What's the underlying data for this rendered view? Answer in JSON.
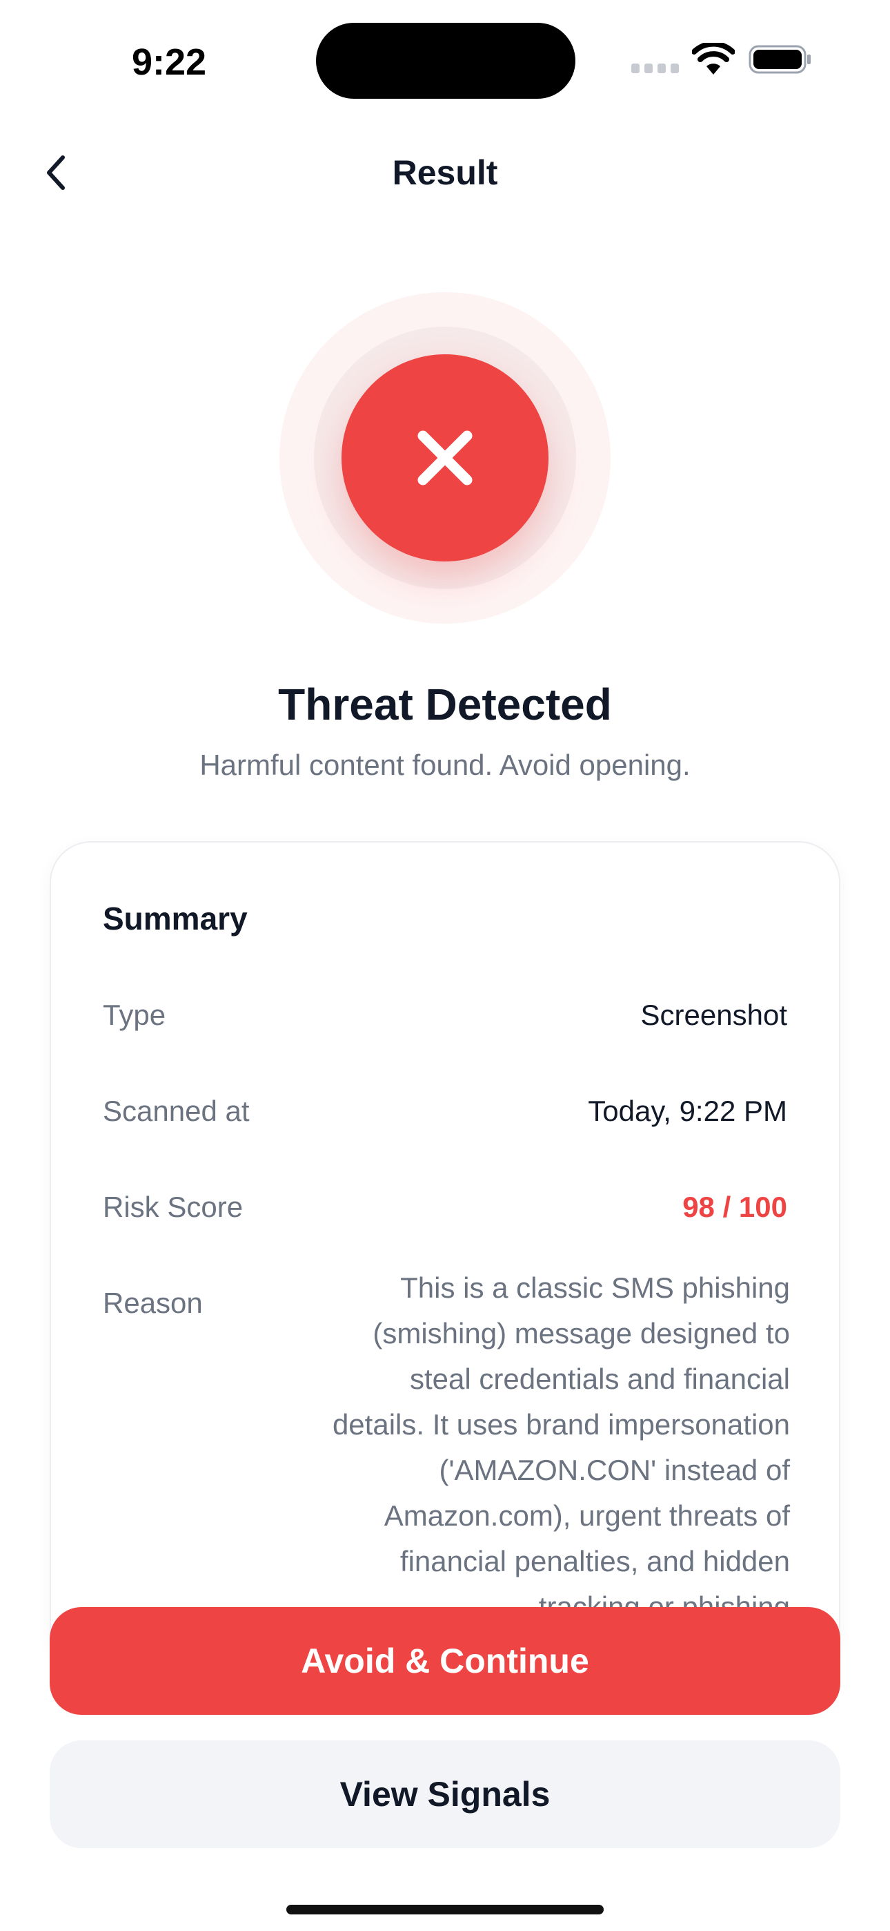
{
  "status_bar": {
    "time": "9:22",
    "icons": [
      "cellular-signal-icon",
      "wifi-icon",
      "battery-icon"
    ]
  },
  "nav": {
    "title": "Result",
    "back_icon": "chevron-left-icon"
  },
  "result": {
    "icon": "x-mark-icon",
    "headline": "Threat Detected",
    "subhead": "Harmful content found. Avoid opening."
  },
  "summary": {
    "title": "Summary",
    "rows": [
      {
        "label": "Type",
        "value": "Screenshot"
      },
      {
        "label": "Scanned at",
        "value": "Today, 9:22 PM"
      },
      {
        "label": "Risk Score",
        "value": "98 / 100"
      },
      {
        "label": "Reason",
        "value": "This is a classic SMS phishing (smishing) message designed to steal credentials and financial details. It uses brand impersonation ('AMAZON.CON' instead of Amazon.com), urgent threats of financial penalties, and hidden tracking or phishing"
      }
    ]
  },
  "actions": {
    "primary_label": "Avoid & Continue",
    "secondary_label": "View Signals"
  },
  "colors": {
    "danger": "#ef4444",
    "text_primary": "#111827",
    "text_secondary": "#6b7280",
    "secondary_button_bg": "#f3f4f7"
  }
}
